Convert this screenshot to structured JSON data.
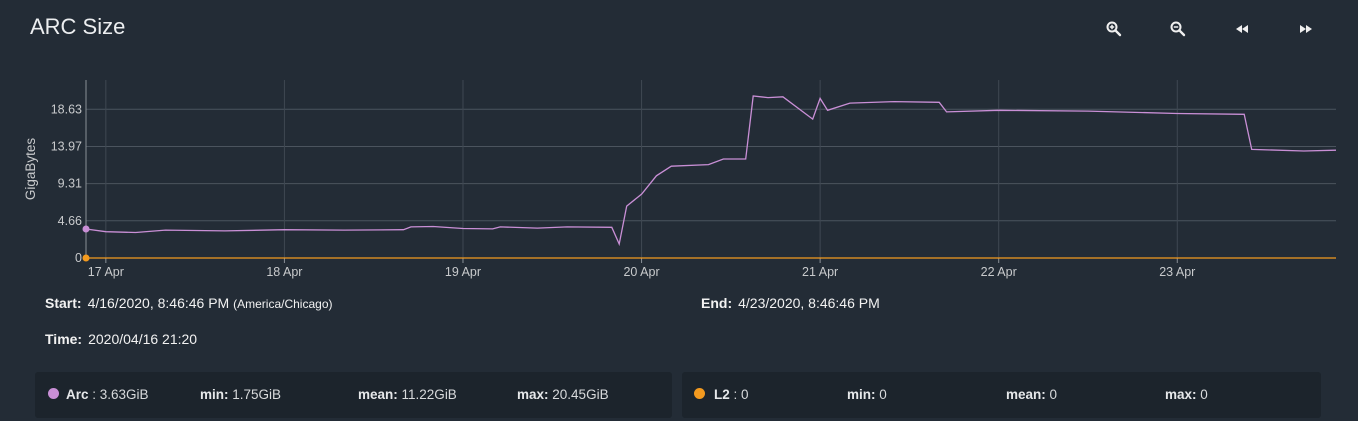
{
  "title": "ARC Size",
  "toolbar": {
    "zoom_in_icon": "zoom-in-icon",
    "zoom_out_icon": "zoom-out-icon",
    "back_icon": "rewind-icon",
    "forward_icon": "fast-forward-icon"
  },
  "chart_data": {
    "type": "line",
    "ylabel": "GigaBytes",
    "xlabel": "",
    "y_ticks": [
      0,
      4.66,
      9.31,
      13.97,
      18.63
    ],
    "y_tick_labels": [
      "0",
      "4.66",
      "9.31",
      "13.97",
      "18.63"
    ],
    "ylim": [
      0,
      22.3
    ],
    "xlim": [
      "2020-04-16 21:20",
      "2020-04-23 21:20"
    ],
    "x_ticks": [
      "2020-04-17 00:00",
      "2020-04-18 00:00",
      "2020-04-19 00:00",
      "2020-04-20 00:00",
      "2020-04-21 00:00",
      "2020-04-22 00:00",
      "2020-04-23 00:00"
    ],
    "x_tick_labels": [
      "17 Apr",
      "18 Apr",
      "19 Apr",
      "20 Apr",
      "21 Apr",
      "22 Apr",
      "23 Apr"
    ],
    "grid": true,
    "series": [
      {
        "name": "Arc",
        "color": "#c98fd6",
        "points": [
          [
            "2020-04-16 21:20",
            3.63
          ],
          [
            "2020-04-17 00:00",
            3.3
          ],
          [
            "2020-04-17 04:00",
            3.2
          ],
          [
            "2020-04-17 08:00",
            3.5
          ],
          [
            "2020-04-17 16:00",
            3.4
          ],
          [
            "2020-04-18 00:00",
            3.55
          ],
          [
            "2020-04-18 08:00",
            3.5
          ],
          [
            "2020-04-18 16:00",
            3.55
          ],
          [
            "2020-04-18 17:00",
            3.9
          ],
          [
            "2020-04-18 20:00",
            3.95
          ],
          [
            "2020-04-19 00:00",
            3.7
          ],
          [
            "2020-04-19 04:00",
            3.65
          ],
          [
            "2020-04-19 05:00",
            3.9
          ],
          [
            "2020-04-19 10:00",
            3.75
          ],
          [
            "2020-04-19 14:00",
            3.9
          ],
          [
            "2020-04-19 20:00",
            3.85
          ],
          [
            "2020-04-19 21:00",
            1.75
          ],
          [
            "2020-04-19 22:00",
            6.5
          ],
          [
            "2020-04-20 00:00",
            8.0
          ],
          [
            "2020-04-20 02:00",
            10.3
          ],
          [
            "2020-04-20 04:00",
            11.5
          ],
          [
            "2020-04-20 09:00",
            11.7
          ],
          [
            "2020-04-20 11:00",
            12.4
          ],
          [
            "2020-04-20 14:00",
            12.4
          ],
          [
            "2020-04-20 15:00",
            20.3
          ],
          [
            "2020-04-20 17:00",
            20.1
          ],
          [
            "2020-04-20 19:00",
            20.2
          ],
          [
            "2020-04-21 00:00",
            20.0
          ],
          [
            "2020-04-20 23:00",
            17.4
          ],
          [
            "2020-04-21 01:00",
            18.5
          ],
          [
            "2020-04-21 04:00",
            19.4
          ],
          [
            "2020-04-21 10:00",
            19.6
          ],
          [
            "2020-04-21 16:00",
            19.5
          ],
          [
            "2020-04-21 17:00",
            18.3
          ],
          [
            "2020-04-22 00:00",
            18.5
          ],
          [
            "2020-04-22 12:00",
            18.4
          ],
          [
            "2020-04-23 00:00",
            18.1
          ],
          [
            "2020-04-23 09:00",
            18.0
          ],
          [
            "2020-04-23 10:00",
            13.6
          ],
          [
            "2020-04-23 17:00",
            13.4
          ],
          [
            "2020-04-23 21:20",
            13.5
          ]
        ]
      },
      {
        "name": "L2",
        "color": "#f39a1f",
        "points": [
          [
            "2020-04-16 21:20",
            0
          ],
          [
            "2020-04-23 21:20",
            0
          ]
        ]
      }
    ]
  },
  "info": {
    "start_label": "Start:",
    "start_value": "4/16/2020, 8:46:46 PM",
    "start_tz": "(America/Chicago)",
    "end_label": "End:",
    "end_value": "4/23/2020, 8:46:46 PM",
    "time_label": "Time:",
    "time_value": "2020/04/16 21:20"
  },
  "legend": {
    "arc": {
      "name": "Arc",
      "current": ": 3.63GiB",
      "min_label": "min:",
      "min_value": "1.75GiB",
      "mean_label": "mean:",
      "mean_value": "11.22GiB",
      "max_label": "max:",
      "max_value": "20.45GiB",
      "color": "#c98fd6"
    },
    "l2": {
      "name": "L2",
      "current": ": 0",
      "min_label": "min:",
      "min_value": "0",
      "mean_label": "mean:",
      "mean_value": "0",
      "max_label": "max:",
      "max_value": "0",
      "color": "#f39a1f"
    }
  }
}
